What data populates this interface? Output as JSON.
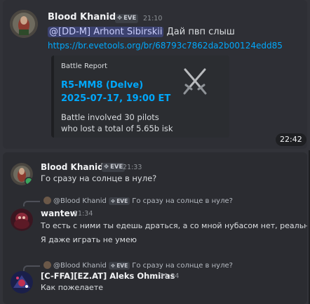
{
  "message1": {
    "author": "Blood Khanid",
    "tag": "EVE",
    "time": "21:10",
    "mention": "@[DD-M] Arhont Sibirskii",
    "text": " Дай пвп слыш",
    "link": "https://br.evetools.org/br/68793c7862da2b00124edd85",
    "embed": {
      "provider": "Battle Report",
      "title_line1": "R5-MM8 (Delve)",
      "title_line2": "2025-07-17, 19:00 ET",
      "desc_line1": "Battle involved 30 pilots",
      "desc_line2": "who lost a total of 5.65b isk",
      "thumbnail": "crossed-swords-icon"
    },
    "hover_timestamp": "22:42"
  },
  "message2": {
    "author": "Blood Khanid",
    "tag": "EVE",
    "time": "21:33",
    "text": "Го сразу на солнце в нуле?"
  },
  "message3": {
    "reply": {
      "author": "@Blood Khanid",
      "tag": "EVE",
      "text": "Го сразу на солнце в нуле?"
    },
    "author": "wantew",
    "time": "21:34",
    "text1": "То есть с ними ты едешь драться, а со мной нубасом нет, реально?",
    "text2": "Я даже играть не умею"
  },
  "message4": {
    "reply": {
      "author": "@Blood Khanid",
      "tag": "EVE",
      "text": "Го сразу на солнце в нуле?"
    },
    "author": "[C-FFA][EZ.AT] Aleks Ohmiras",
    "time": "21:34",
    "text": "Как пожелаете"
  },
  "colors": {
    "link": "#00a8fc",
    "background": "#313338",
    "mention_bg": "#3c4270"
  }
}
